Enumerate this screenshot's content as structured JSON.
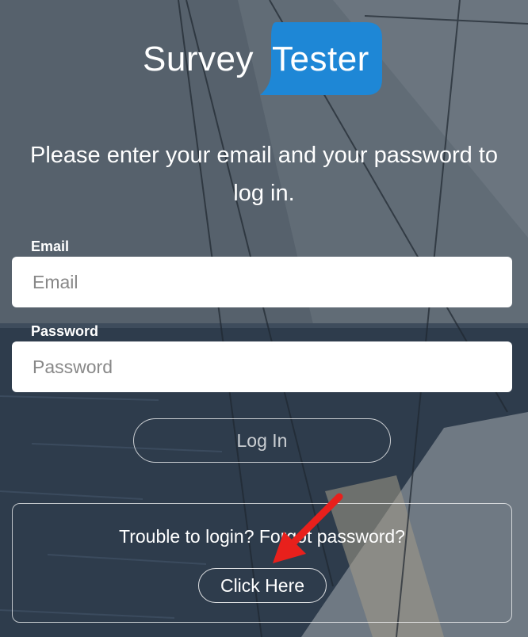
{
  "logo": {
    "word1": "Survey",
    "word2": "Tester",
    "bubble_color": "#1e87d6"
  },
  "intro": {
    "text": "Please enter your email and your password to log in."
  },
  "email": {
    "label": "Email",
    "placeholder": "Email",
    "value": ""
  },
  "password": {
    "label": "Password",
    "placeholder": "Password",
    "value": ""
  },
  "login": {
    "label": "Log In"
  },
  "help": {
    "text": "Trouble to login? Forgot password?",
    "button_label": "Click Here"
  },
  "annotation": {
    "arrow_color": "#e8201c",
    "arrow_icon": "red-arrow-icon"
  }
}
